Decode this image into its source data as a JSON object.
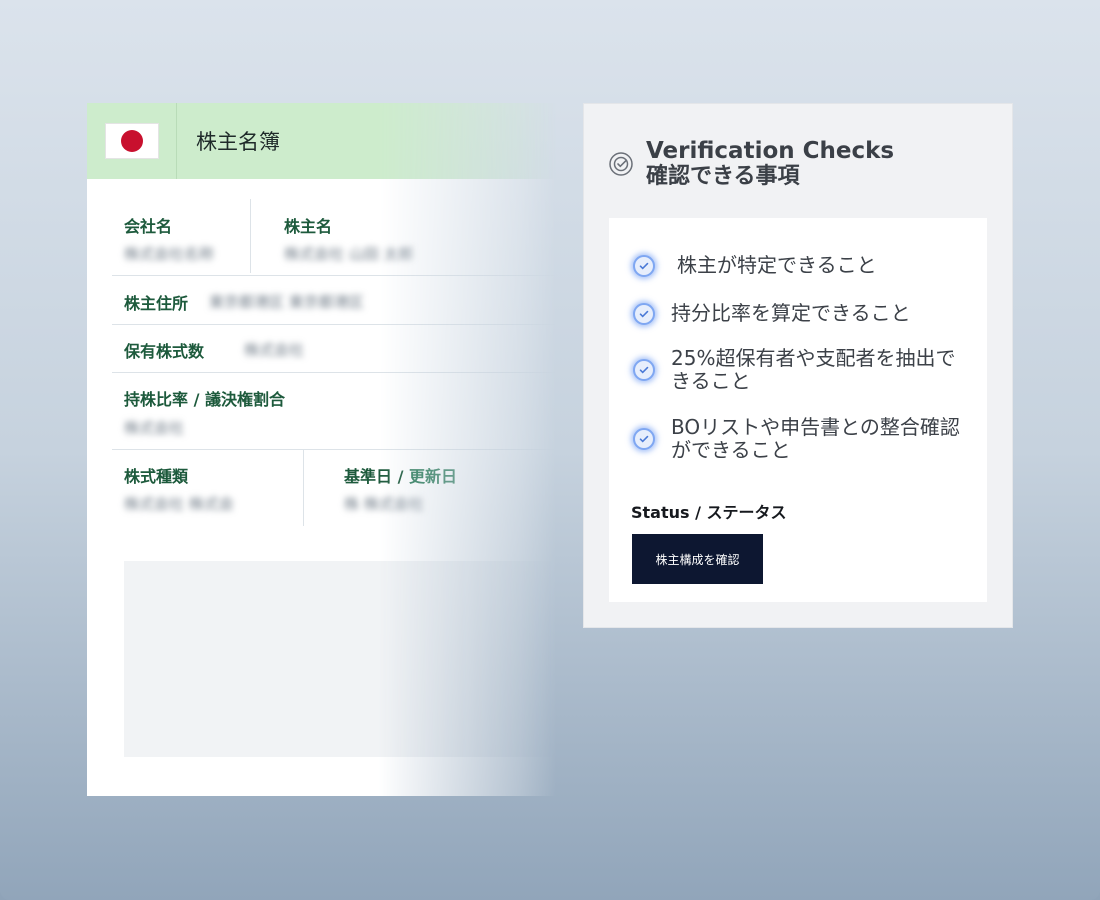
{
  "registry": {
    "title": "株主名簿",
    "fields": {
      "company_name_label": "会社名",
      "company_name_value": "株式会社名称",
      "shareholder_name_label": "株主名",
      "shareholder_name_value": "株式会社 山田 太郎",
      "shareholder_address_label": "株主住所",
      "shareholder_address_value": "東京都港区 東京都港区",
      "shares_held_label": "保有株式数",
      "shares_held_value": "株式会社",
      "ratio_label": "持株比率 / 議決権割合",
      "ratio_value": "株式会社",
      "share_type_label": "株式種類",
      "share_type_value": "株式会社 株式会",
      "base_date_label_a": "基準日 /",
      "base_date_label_b": "更新日",
      "base_date_value": "株 株式会社"
    }
  },
  "verification": {
    "title_en": "Verification Checks",
    "title_ja": "確認できる事項",
    "checks": [
      "株主が特定できること",
      "持分比率を算定できること",
      "25%超保有者や支配者を抽出できること",
      "BOリストや申告書との整合確認ができること"
    ],
    "status_label": "Status / ステータス",
    "status_button": "株主構成を確認"
  },
  "colors": {
    "header_green": "#cdeccc",
    "label_green": "#1d5a3c",
    "check_blue": "#7fa7f2",
    "button_navy": "#0d1731"
  }
}
